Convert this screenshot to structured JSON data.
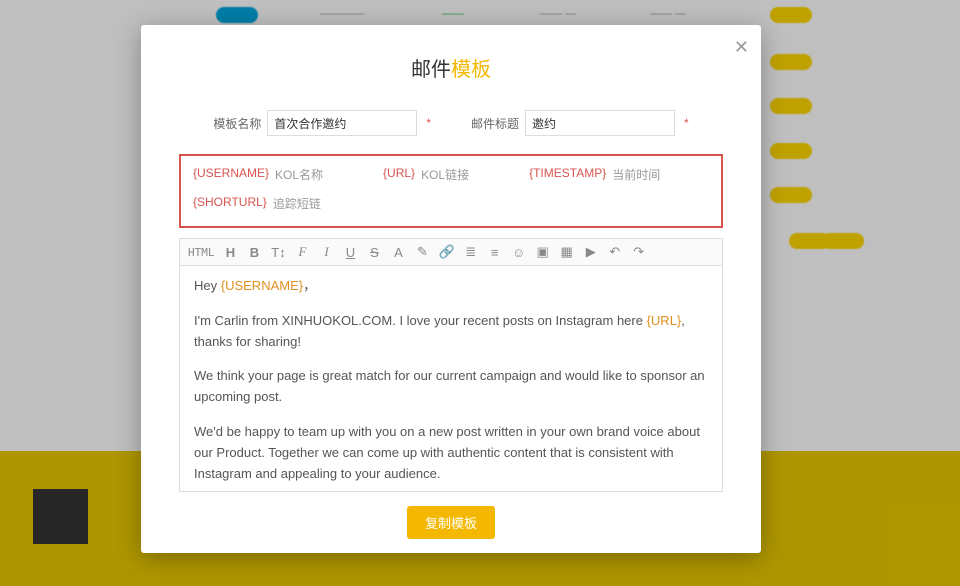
{
  "modal": {
    "title_prefix": "邮件",
    "title_accent": "模板",
    "template_name_label": "模板名称",
    "template_name_value": "首次合作邀约",
    "email_subject_label": "邮件标题",
    "email_subject_value": "邀约"
  },
  "variables": [
    {
      "tag": "{USERNAME}",
      "desc": "KOL名称"
    },
    {
      "tag": "{URL}",
      "desc": "KOL链接"
    },
    {
      "tag": "{TIMESTAMP}",
      "desc": "当前时间"
    },
    {
      "tag": "{SHORTURL}",
      "desc": "追踪短链"
    }
  ],
  "toolbar": {
    "html": "HTML",
    "heading": "H",
    "bold": "B",
    "fontsize": "T↕",
    "font": "F",
    "italic": "I",
    "underline": "U",
    "strike": "S",
    "color": "A",
    "highlight": "✎",
    "link": "🔗",
    "ol": "≣",
    "ul": "≡",
    "emoji": "☺",
    "image": "▣",
    "table": "▦",
    "video": "▶",
    "undo": "↶",
    "redo": "↷"
  },
  "editor": {
    "greeting_pre": "Hey ",
    "greeting_ph": "{USERNAME}",
    "greeting_post": "，",
    "p2_pre": "I'm Carlin from XINHUOKOL.COM. I love your recent posts on Instagram here ",
    "p2_ph": "{URL}",
    "p2_post": ", thanks for sharing!",
    "p3": "We think your page is great match for our current campaign and would like to sponsor an upcoming post.",
    "p4": "We'd be happy to team up with you on a new post written in your own brand voice about our Product. Together we can come up with authentic content that is consistent with Instagram and appealing to your audience."
  },
  "footer": {
    "copy_label": "复制模板"
  },
  "bg": {
    "pill_blue": "　　",
    "pill_yellow": "　　"
  }
}
